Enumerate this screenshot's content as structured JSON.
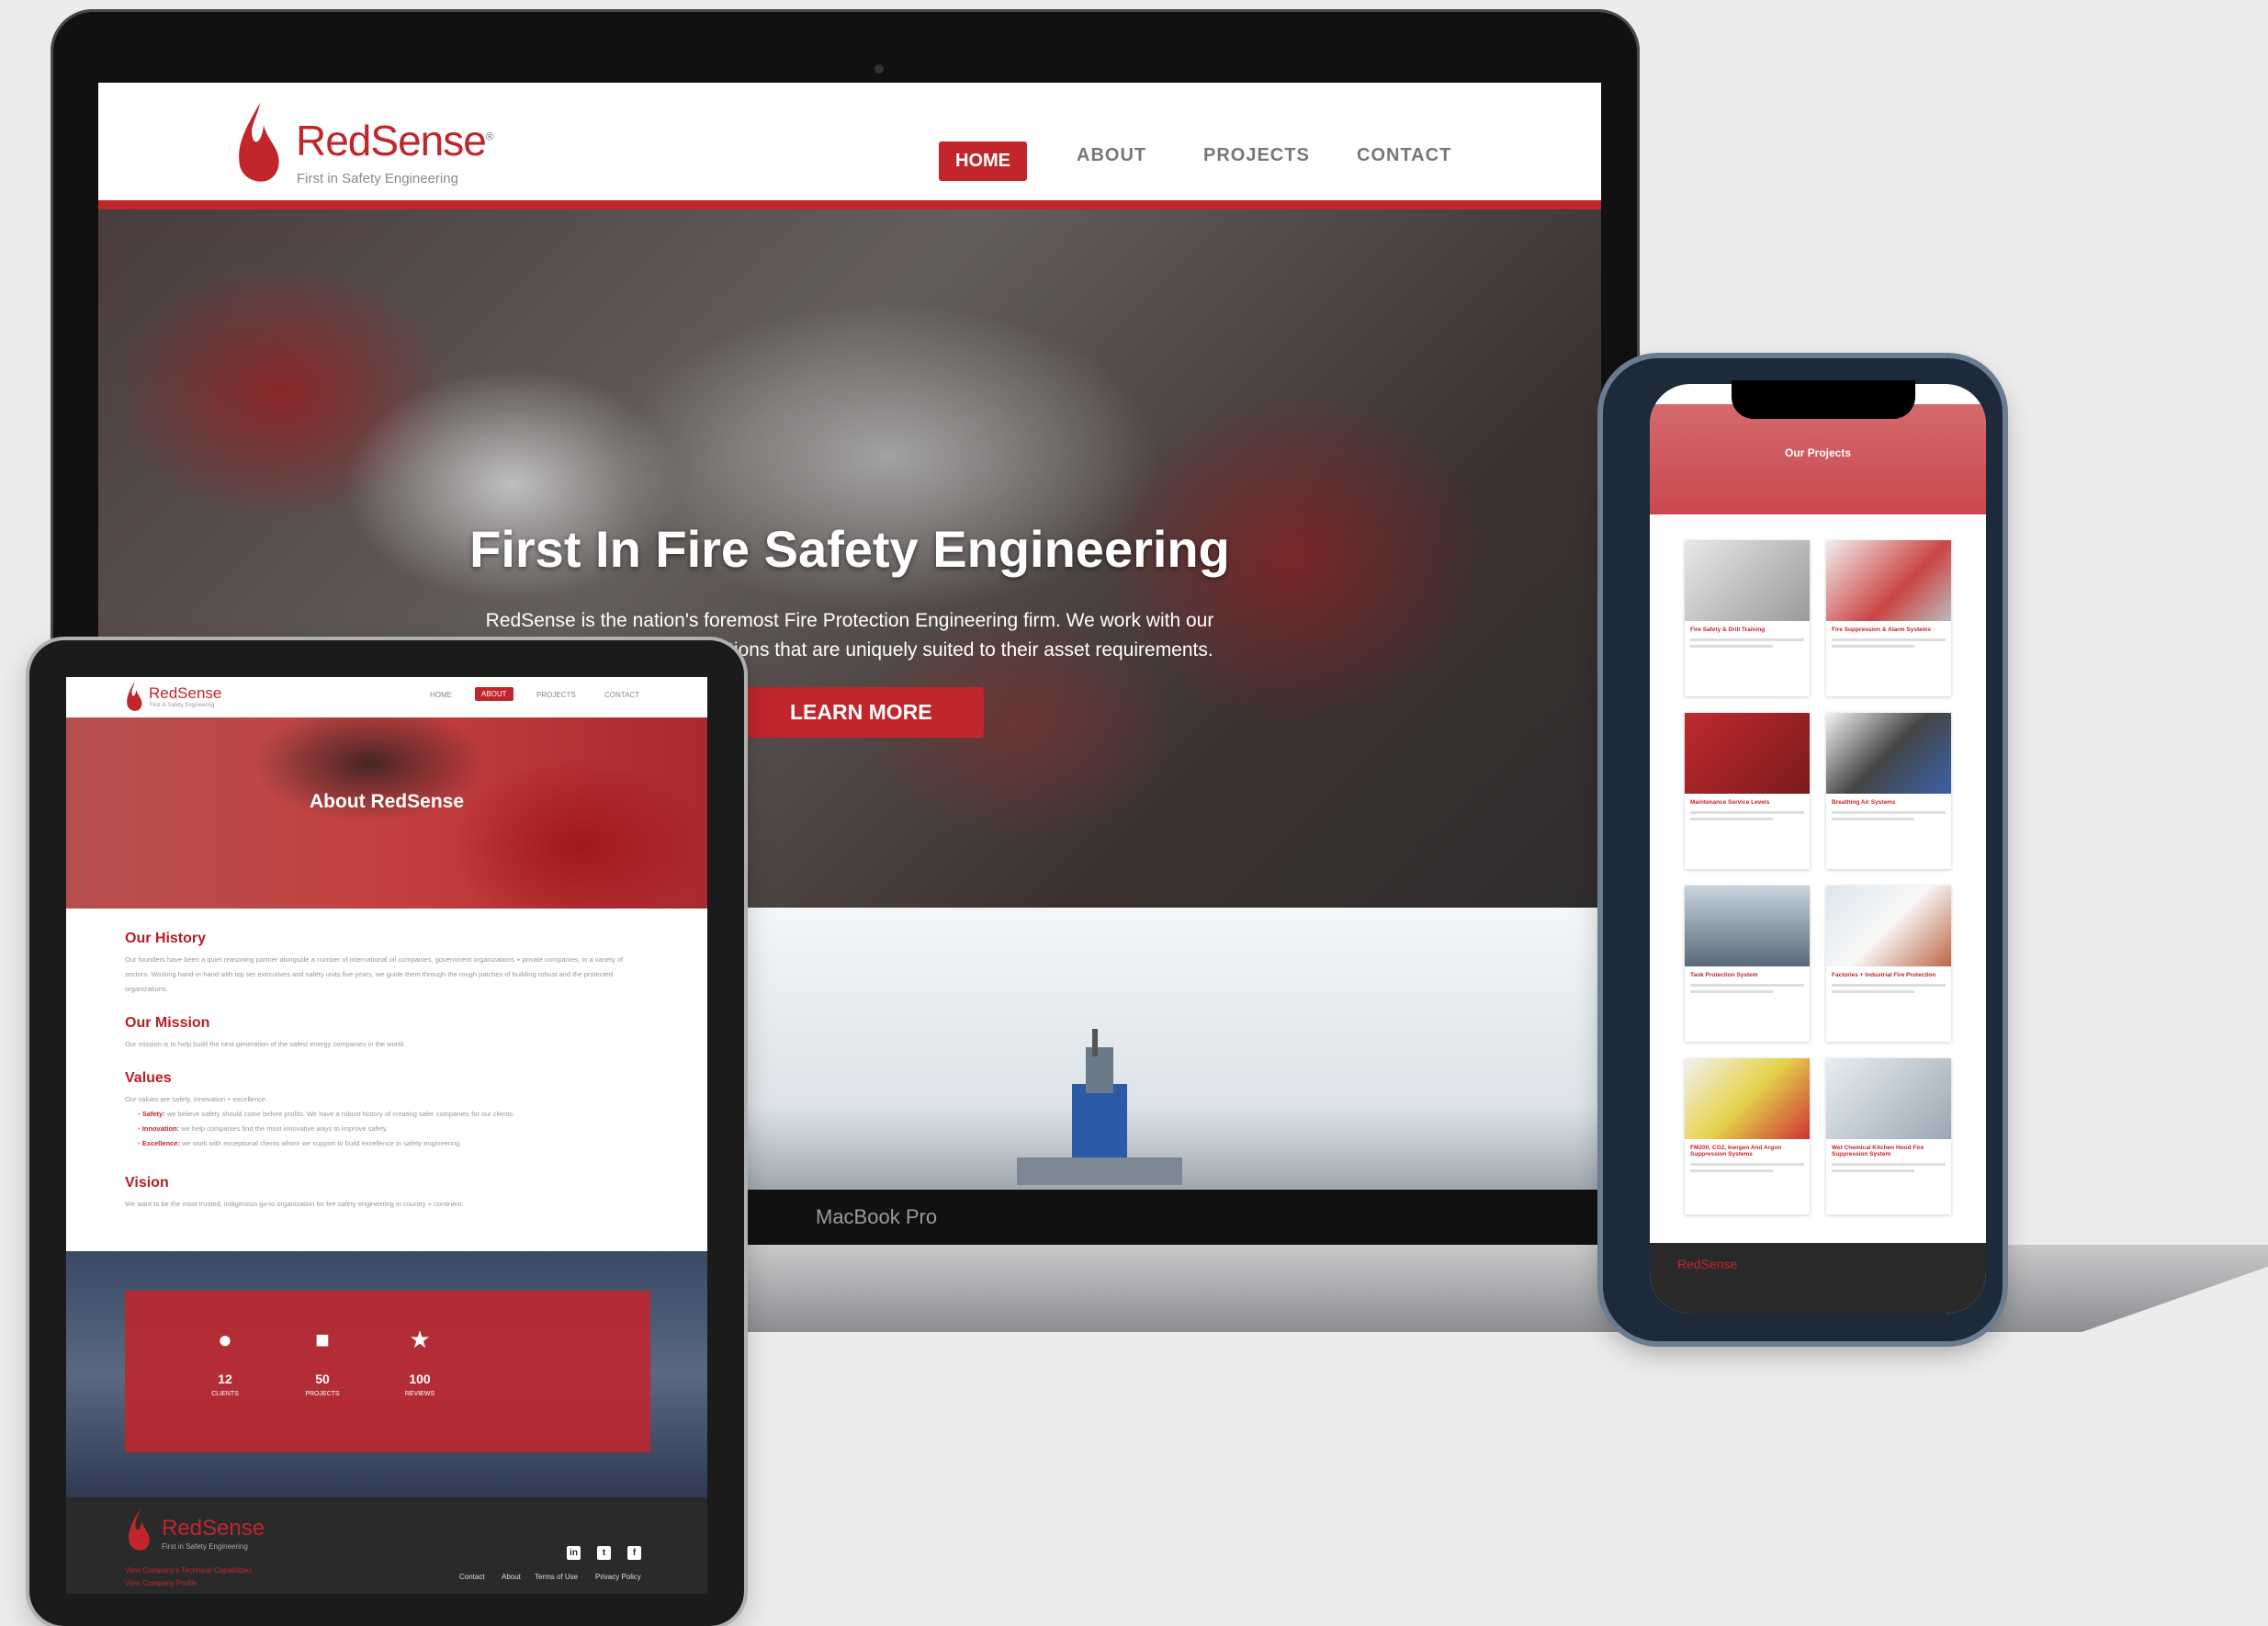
{
  "colors": {
    "brand_red": "#c0262c",
    "dark_footer": "#2a2a2a",
    "muted_text": "#999999"
  },
  "laptop": {
    "device_label": "MacBook Pro",
    "site": {
      "brand": "RedSense",
      "registered": "®",
      "tagline": "First in Safety Engineering",
      "nav": [
        "HOME",
        "ABOUT",
        "PROJECTS",
        "CONTACT"
      ],
      "active_nav": "HOME",
      "hero": {
        "title": "First In Fire Safety Engineering",
        "subtitle": "RedSense is the nation's foremost Fire Protection Engineering firm. We work with our clients to provide safety solutions that are uniquely suited to their asset requirements.",
        "button": "LEARN MORE"
      }
    }
  },
  "tablet": {
    "site": {
      "brand": "RedSense",
      "tagline": "First in Safety Engineering",
      "nav": [
        "HOME",
        "ABOUT",
        "PROJECTS",
        "CONTACT"
      ],
      "active_nav": "ABOUT",
      "hero_title": "About RedSense",
      "sections": {
        "history_title": "Our History",
        "history_text": "Our founders have been a quiet reasoning partner alongside a number of international oil companies, government organizations + private companies, in a variety of sectors. Working hand-in-hand with top tier executives and safety units five years, we guide them through the rough patches of building robust and the protected organizations.",
        "mission_title": "Our Mission",
        "mission_text": "Our mission is to help build the next generation of the safest energy companies in the world.",
        "values_title": "Values",
        "values_intro": "Our values are safety, innovation + excellence.",
        "values": [
          {
            "label": "Safety:",
            "text": "we believe safety should come before profits. We have a robust history of creating safer companies for our clients."
          },
          {
            "label": "Innovation:",
            "text": "we help companies find the most innovative ways to improve safety."
          },
          {
            "label": "Excellence:",
            "text": "we work with exceptional clients whom we support to build excellence in safety engineering."
          }
        ],
        "vision_title": "Vision",
        "vision_text": "We want to be the most trusted, indigenous go-to organization for fire safety engineering in country + continent."
      },
      "stats": [
        {
          "icon": "user-icon",
          "value": "12",
          "label": "CLIENTS"
        },
        {
          "icon": "folder-icon",
          "value": "50",
          "label": "PROJECTS"
        },
        {
          "icon": "star-icon",
          "value": "100",
          "label": "REVIEWS"
        }
      ],
      "footer": {
        "brand": "RedSense",
        "tagline": "First in Safety Engineering",
        "links": [
          "View Company's Technical Capabilities",
          "View Company Profile"
        ],
        "nav": [
          "Contact",
          "About",
          "Terms of Use",
          "Privacy Policy"
        ],
        "social": [
          "in",
          "t",
          "f"
        ]
      }
    }
  },
  "phone": {
    "site": {
      "brand": "RedSense",
      "hero_title": "Our Projects",
      "projects": [
        "Fire Safety & Drill Training",
        "Fire Suppression & Alarm Systems",
        "Maintenance Service Levels",
        "Breathing Air Systems",
        "Tank Protection System",
        "Factories + Industrial Fire Protection",
        "FM200, CO2, Inergen And Argon Suppression Systems",
        "Wet Chemical Kitchen Hood Fire Suppression System"
      ],
      "footer_brand": "RedSense"
    }
  }
}
